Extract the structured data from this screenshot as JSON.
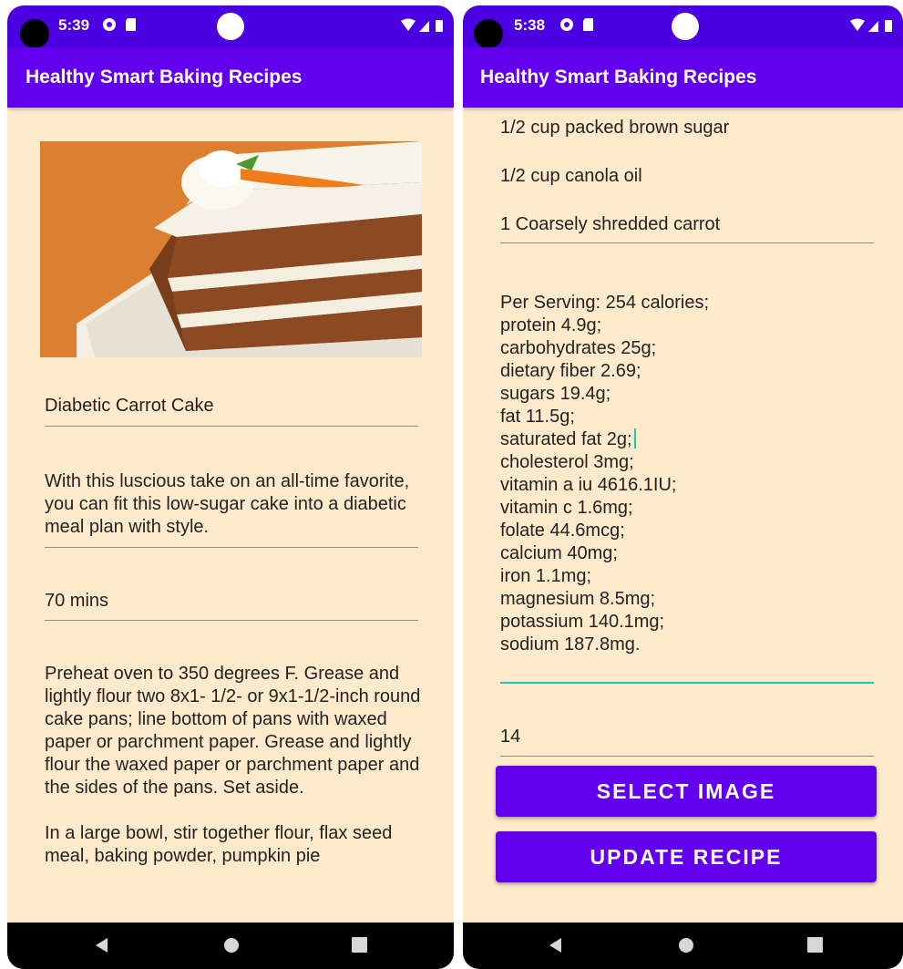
{
  "left_screen": {
    "status_bar": {
      "time": "5:39"
    },
    "app_bar": {
      "title": "Healthy Smart Baking Recipes"
    },
    "recipe_image": {
      "icon": "carrot-cake-image"
    },
    "name_field": {
      "value": "Diabetic Carrot Cake"
    },
    "description_field": {
      "value": "With this luscious take on an all-time favorite, you can fit this low-sugar cake into a diabetic meal plan with style."
    },
    "time_field": {
      "value": "70 mins"
    },
    "instructions": {
      "paragraph1": "Preheat oven to 350 degrees F. Grease and lightly flour two 8x1- 1/2- or 9x1-1/2-inch round cake pans; line bottom of pans with waxed paper or parchment paper. Grease and lightly flour the waxed paper or parchment paper and the sides of the pans. Set aside.",
      "paragraph2": "In a large bowl, stir together flour, flax seed meal, baking powder, pumpkin pie"
    }
  },
  "right_screen": {
    "status_bar": {
      "time": "5:38"
    },
    "app_bar": {
      "title": "Healthy Smart Baking Recipes"
    },
    "ingredients": [
      "1/2 cup packed brown sugar",
      "1/2 cup canola oil",
      "1 Coarsely shredded carrot"
    ],
    "nutrition": [
      "Per Serving: 254 calories;",
      "protein 4.9g;",
      "carbohydrates 25g;",
      "dietary fiber 2.69;",
      "sugars 19.4g;",
      "fat 11.5g;",
      "saturated fat 2g;",
      "cholesterol 3mg;",
      "vitamin a iu 4616.1IU;",
      "vitamin c 1.6mg;",
      "folate 44.6mcg;",
      "calcium 40mg;",
      "iron 1.1mg;",
      "magnesium 8.5mg;",
      "potassium 140.1mg;",
      "sodium 187.8mg."
    ],
    "servings_field": {
      "value": "14"
    },
    "select_image_button": "SELECT IMAGE",
    "update_recipe_button": "UPDATE RECIPE"
  },
  "colors": {
    "status_bar": "#4a00e0",
    "app_bar": "#6200ee",
    "background": "#ffebcc",
    "accent": "#18c7b8"
  }
}
